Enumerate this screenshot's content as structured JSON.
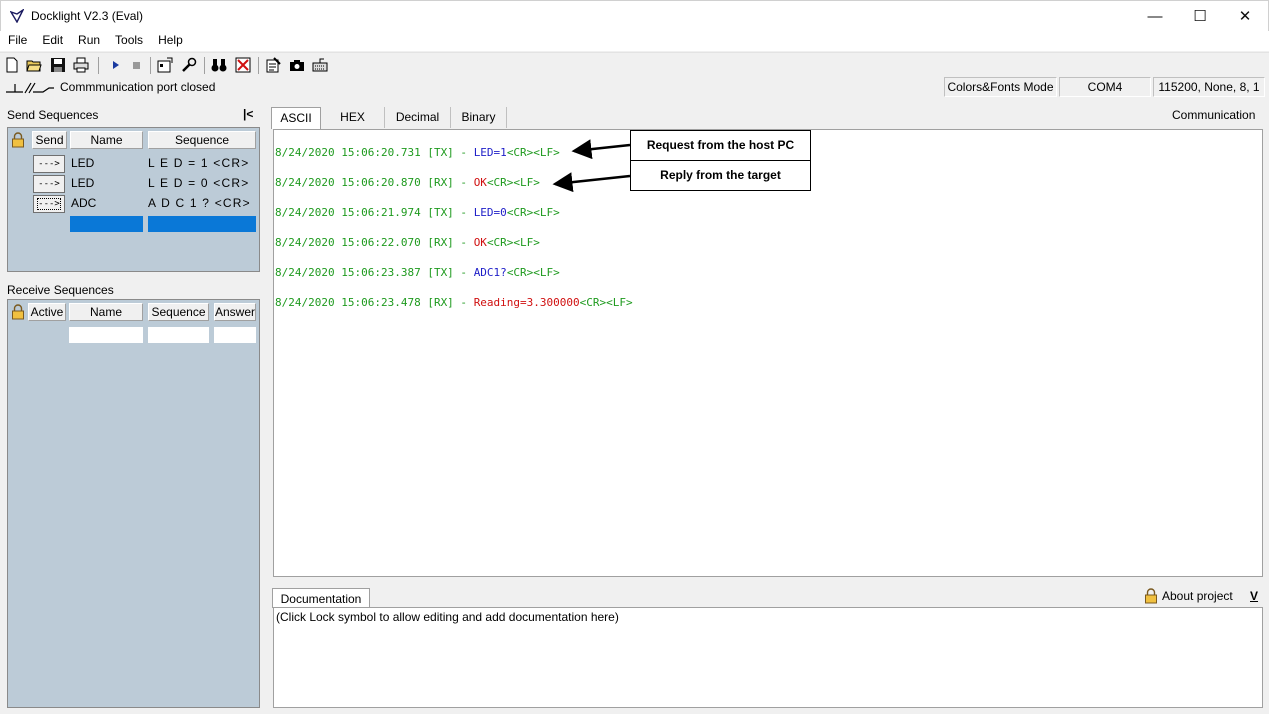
{
  "window": {
    "title": "Docklight V2.3 (Eval)",
    "min": "—",
    "max": "☐",
    "close": "✕"
  },
  "menu": [
    "File",
    "Edit",
    "Run",
    "Tools",
    "Help"
  ],
  "status": {
    "connection": "Commmunication port closed",
    "mode": "Colors&Fonts Mode",
    "port": "COM4",
    "settings": "115200, None, 8, 1"
  },
  "send": {
    "label": "Send Sequences",
    "pin": "|<",
    "headers": {
      "send": "Send",
      "name": "Name",
      "sequence": "Sequence"
    },
    "rows": [
      {
        "btn": "--->",
        "name": "LED",
        "sequence": "L E D = 1 <CR>"
      },
      {
        "btn": "--->",
        "name": "LED",
        "sequence": "L E D = 0 <CR>"
      },
      {
        "btn": "--->",
        "name": "ADC",
        "sequence": "A D C 1 ? <CR>"
      }
    ]
  },
  "receive": {
    "label": "Receive Sequences",
    "headers": {
      "active": "Active",
      "name": "Name",
      "sequence": "Sequence",
      "answer": "Answer"
    }
  },
  "tabs": [
    "ASCII",
    "HEX",
    "Decimal",
    "Binary"
  ],
  "comm_label": "Communication",
  "log": [
    {
      "ts": "8/24/2020 15:06:20.731 [TX] - ",
      "dir": "tx",
      "payload": "LED=1",
      "ctl": "<CR><LF>"
    },
    {
      "ts": "8/24/2020 15:06:20.870 [RX] - ",
      "dir": "rx",
      "payload": "OK",
      "ctl": "<CR><LF>"
    },
    {
      "ts": "8/24/2020 15:06:21.974 [TX] - ",
      "dir": "tx",
      "payload": "LED=0",
      "ctl": "<CR><LF>"
    },
    {
      "ts": "8/24/2020 15:06:22.070 [RX] - ",
      "dir": "rx",
      "payload": "OK",
      "ctl": "<CR><LF>"
    },
    {
      "ts": "8/24/2020 15:06:23.387 [TX] - ",
      "dir": "tx",
      "payload": "ADC1?",
      "ctl": "<CR><LF>"
    },
    {
      "ts": "8/24/2020 15:06:23.478 [RX] - ",
      "dir": "rx",
      "payload": "Reading=3.300000",
      "ctl": "<CR><LF>"
    }
  ],
  "callouts": {
    "request": "Request from the host PC",
    "reply": "Reply from the target"
  },
  "doc": {
    "tab": "Documentation",
    "about": "About project",
    "toggle": "V",
    "text": "(Click Lock symbol to allow editing and add documentation here)"
  },
  "colors": {
    "timestamp": "#1e9a1e",
    "tx": "#1e1ec8",
    "rx": "#d01010",
    "panel": "#bccbd7",
    "selection": "#0a78d7"
  }
}
